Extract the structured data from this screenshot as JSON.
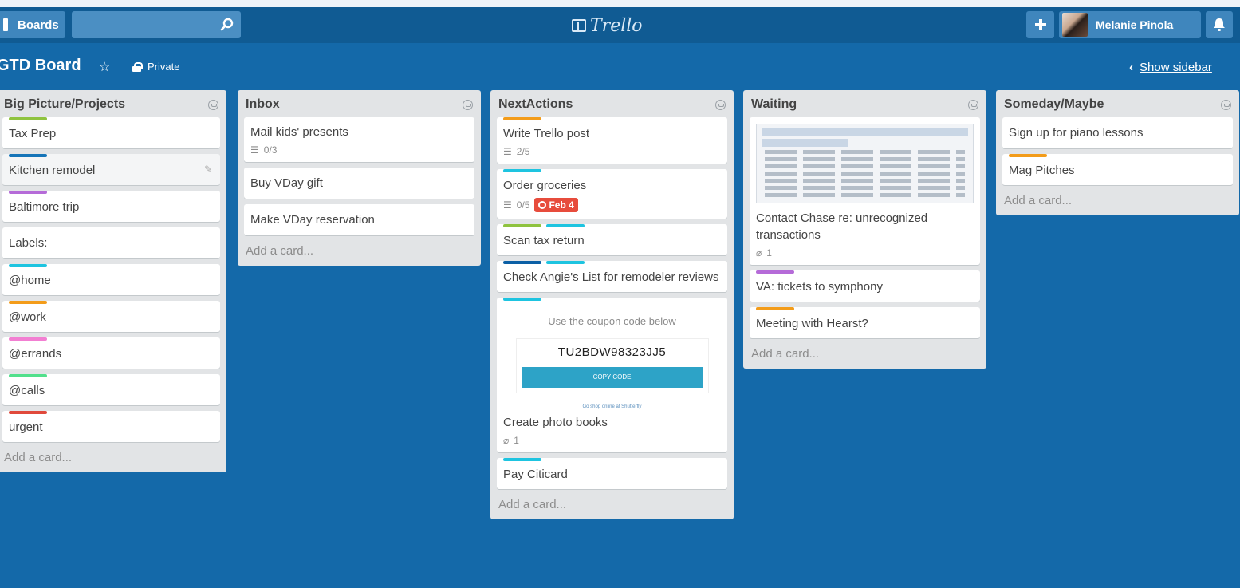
{
  "header": {
    "boards_label": "Boards",
    "logo_text": "Trello",
    "user_name": "Melanie Pinola"
  },
  "board": {
    "title": "GTD Board",
    "visibility": "Private",
    "show_sidebar": "Show sidebar"
  },
  "colors": {
    "green": "#8fc33f",
    "blue": "#1574b8",
    "purple": "#b56bd8",
    "cyan": "#1ec4e0",
    "orange": "#f39c1a",
    "pink": "#f27fd2",
    "lime": "#52e08c",
    "red": "#e0493b",
    "navy": "#0b5fa5"
  },
  "lists": [
    {
      "title": "Big Picture/Projects",
      "add_card": "Add a card...",
      "cards": [
        {
          "title": "Tax Prep",
          "labels": [
            "green"
          ]
        },
        {
          "title": "Kitchen remodel",
          "labels": [
            "blue"
          ]
        },
        {
          "title": "Baltimore trip",
          "labels": [
            "purple"
          ]
        },
        {
          "title": "Labels:",
          "labels": []
        },
        {
          "title": "@home",
          "labels": [
            "cyan"
          ]
        },
        {
          "title": "@work",
          "labels": [
            "orange"
          ]
        },
        {
          "title": "@errands",
          "labels": [
            "pink"
          ]
        },
        {
          "title": "@calls",
          "labels": [
            "lime"
          ]
        },
        {
          "title": "urgent",
          "labels": [
            "red"
          ]
        }
      ]
    },
    {
      "title": "Inbox",
      "add_card": "Add a card...",
      "cards": [
        {
          "title": "Mail kids' presents",
          "checklist": "0/3"
        },
        {
          "title": "Buy VDay gift"
        },
        {
          "title": "Make VDay reservation"
        }
      ]
    },
    {
      "title": "NextActions",
      "add_card": "Add a card...",
      "cards": [
        {
          "title": "Write Trello post",
          "labels": [
            "orange"
          ],
          "checklist": "2/5"
        },
        {
          "title": "Order groceries",
          "labels": [
            "cyan"
          ],
          "checklist": "0/5",
          "due": "Feb 4"
        },
        {
          "title": "Scan tax return",
          "labels": [
            "green",
            "cyan"
          ]
        },
        {
          "title": "Check Angie's List for remodeler reviews",
          "labels": [
            "navy",
            "cyan"
          ]
        },
        {
          "title": "Create photo books",
          "labels": [
            "cyan"
          ],
          "attachments": "1",
          "coupon": {
            "heading": "Use the coupon code below",
            "code": "TU2BDW98323JJ5",
            "button": "COPY CODE",
            "link": "Go shop online at Shutterfly"
          }
        },
        {
          "title": "Pay Citicard",
          "labels": [
            "cyan"
          ]
        }
      ]
    },
    {
      "title": "Waiting",
      "add_card": "Add a card...",
      "cards": [
        {
          "title": "Contact Chase re: unrecognized transactions",
          "attachments": "1",
          "has_cover": true
        },
        {
          "title": "VA: tickets to symphony",
          "labels": [
            "purple"
          ]
        },
        {
          "title": "Meeting with Hearst?",
          "labels": [
            "orange"
          ]
        }
      ]
    },
    {
      "title": "Someday/Maybe",
      "add_card": "Add a card...",
      "cards": [
        {
          "title": "Sign up for piano lessons"
        },
        {
          "title": "Mag Pitches",
          "labels": [
            "orange"
          ]
        }
      ]
    }
  ]
}
